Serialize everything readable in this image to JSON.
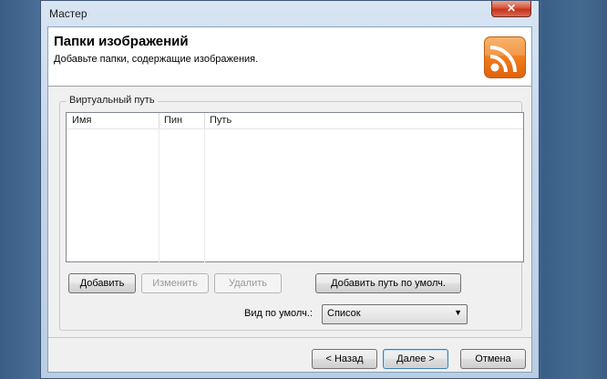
{
  "window": {
    "title": "Мастер",
    "close_glyph": "✕"
  },
  "header": {
    "title": "Папки изображений",
    "subtitle": "Добавьте папки, содержащие изображения.",
    "logo_icon": "rss-feed-icon",
    "logo_color": "#ee7a1a"
  },
  "group": {
    "label": "Виртуальный путь"
  },
  "table": {
    "columns": [
      "Имя",
      "Пин",
      "Путь"
    ],
    "rows": []
  },
  "buttons": {
    "add": "Добавить",
    "edit": "Изменить",
    "delete": "Удалить",
    "add_default_path": "Добавить путь по умолч."
  },
  "view": {
    "label": "Вид по умолч.:",
    "selected": "Список"
  },
  "footer": {
    "back": "< Назад",
    "next": "Далее >",
    "cancel": "Отмена"
  }
}
